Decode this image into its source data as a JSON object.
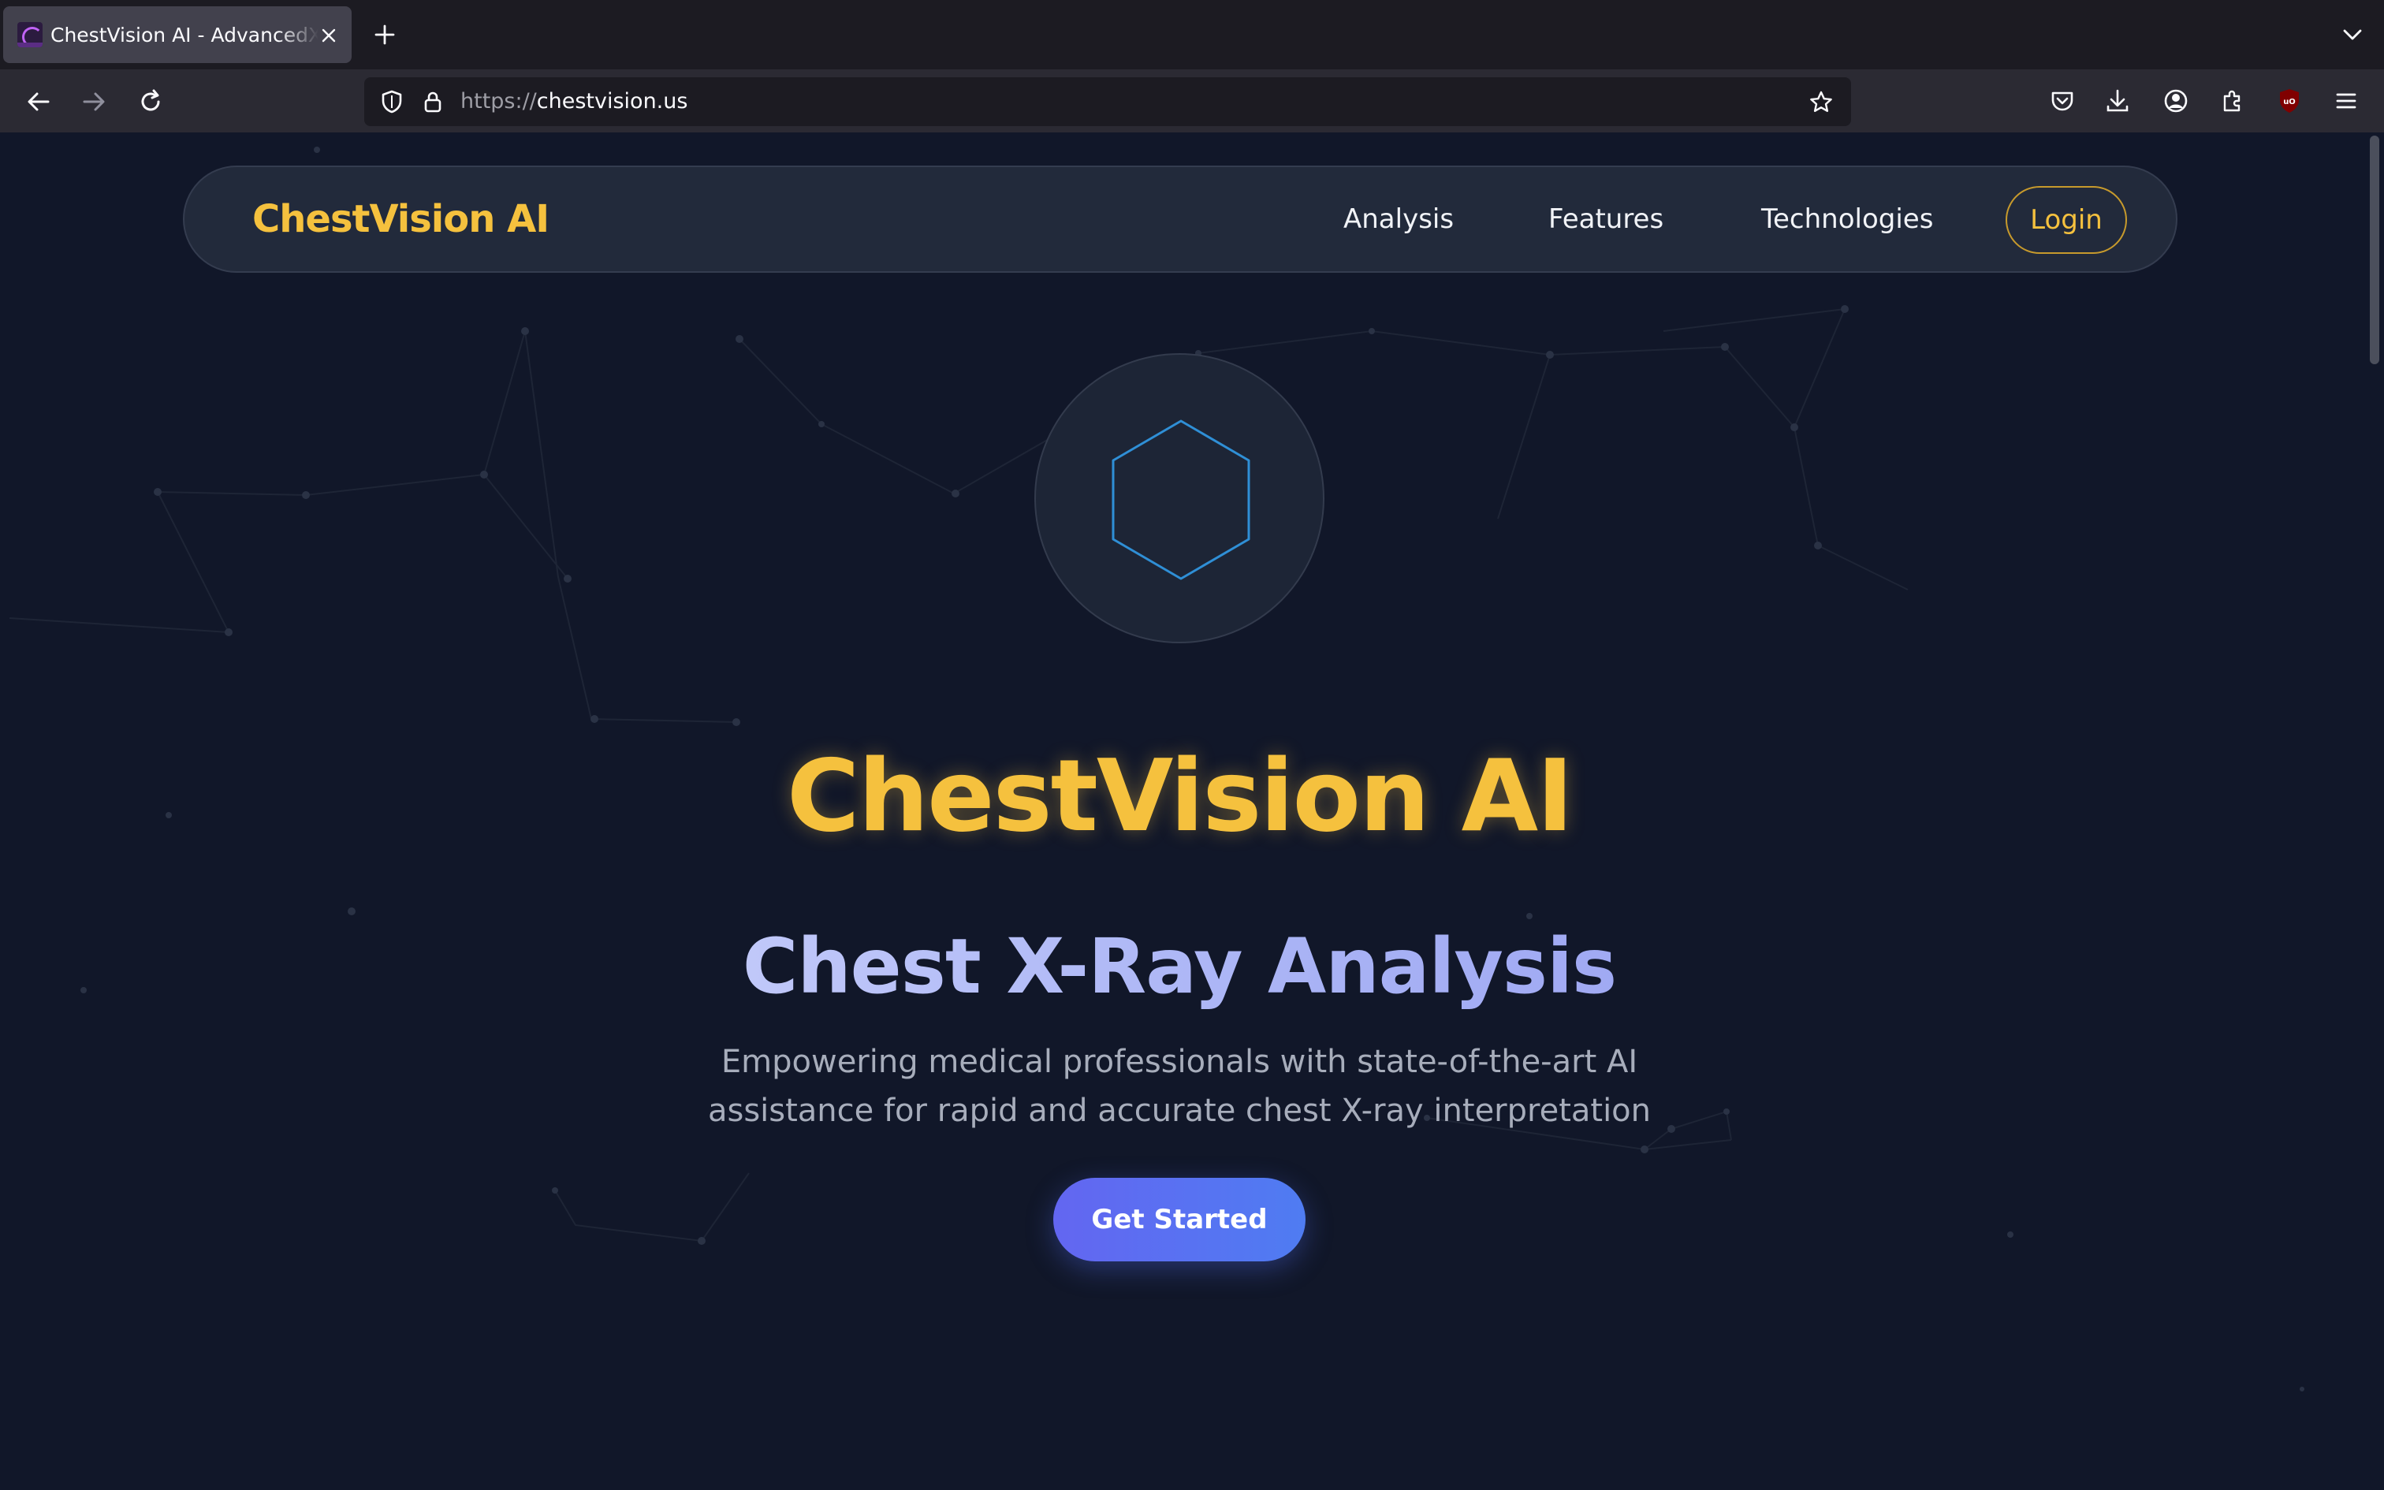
{
  "browser": {
    "tab": {
      "title": "ChestVision AI - AdvancedX-Ray",
      "favicon": "chestvision-favicon-icon"
    },
    "url": {
      "protocol": "https://",
      "host": "chestvision.us"
    },
    "toolbar_icons": [
      "back-icon",
      "forward-icon",
      "reload-icon",
      "shield-icon",
      "lock-icon",
      "bookmark-star-icon",
      "pocket-icon",
      "downloads-icon",
      "account-icon",
      "extensions-icon",
      "ublock-icon",
      "menu-icon"
    ]
  },
  "site": {
    "logo": "ChestVision AI",
    "nav": {
      "analysis": "Analysis",
      "features": "Features",
      "technologies": "Technologies",
      "login": "Login"
    },
    "hero": {
      "icon": "hexagon-icon",
      "title": "ChestVision AI",
      "subtitle": "Chest X-Ray Analysis",
      "description": "Empowering medical professionals with state-of-the-art AI assistance for rapid and accurate chest X-ray interpretation",
      "cta": "Get Started"
    }
  },
  "colors": {
    "page_background": "#111729",
    "accent_gold": "#f5c13e",
    "cta_gradient_start": "#6366f1",
    "cta_gradient_end": "#4f7cf2",
    "subtitle_gradient_start": "#dfe4ff",
    "subtitle_gradient_end": "#8c93ee",
    "hexagon_stroke": "#2f8fd6"
  }
}
